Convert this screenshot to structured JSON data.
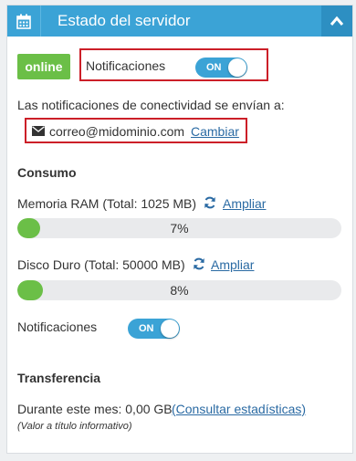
{
  "header": {
    "title": "Estado del servidor"
  },
  "status": {
    "badge": "online",
    "notifications_label": "Notificaciones",
    "toggle_text": "ON"
  },
  "connectivity": {
    "info": "Las notificaciones de conectividad se envían a:",
    "email": "correo@midominio.com",
    "change_link": "Cambiar"
  },
  "consumption": {
    "title": "Consumo",
    "ram": {
      "label": "Memoria RAM (Total: 1025 MB)",
      "action": "Ampliar",
      "percent_text": "7%",
      "percent": 7
    },
    "disk": {
      "label": "Disco Duro (Total: 50000 MB)",
      "action": "Ampliar",
      "percent_text": "8%",
      "percent": 8
    },
    "notifications_label": "Notificaciones",
    "toggle_text": "ON"
  },
  "transfer": {
    "title": "Transferencia",
    "month_label": "Durante este mes: 0,00 GB",
    "stats_link": "(Consultar estadísticas)",
    "note": "(Valor a título informativo)"
  },
  "colors": {
    "accent": "#3ba3d6",
    "online": "#6bbf47",
    "highlight": "#cc1f28"
  }
}
